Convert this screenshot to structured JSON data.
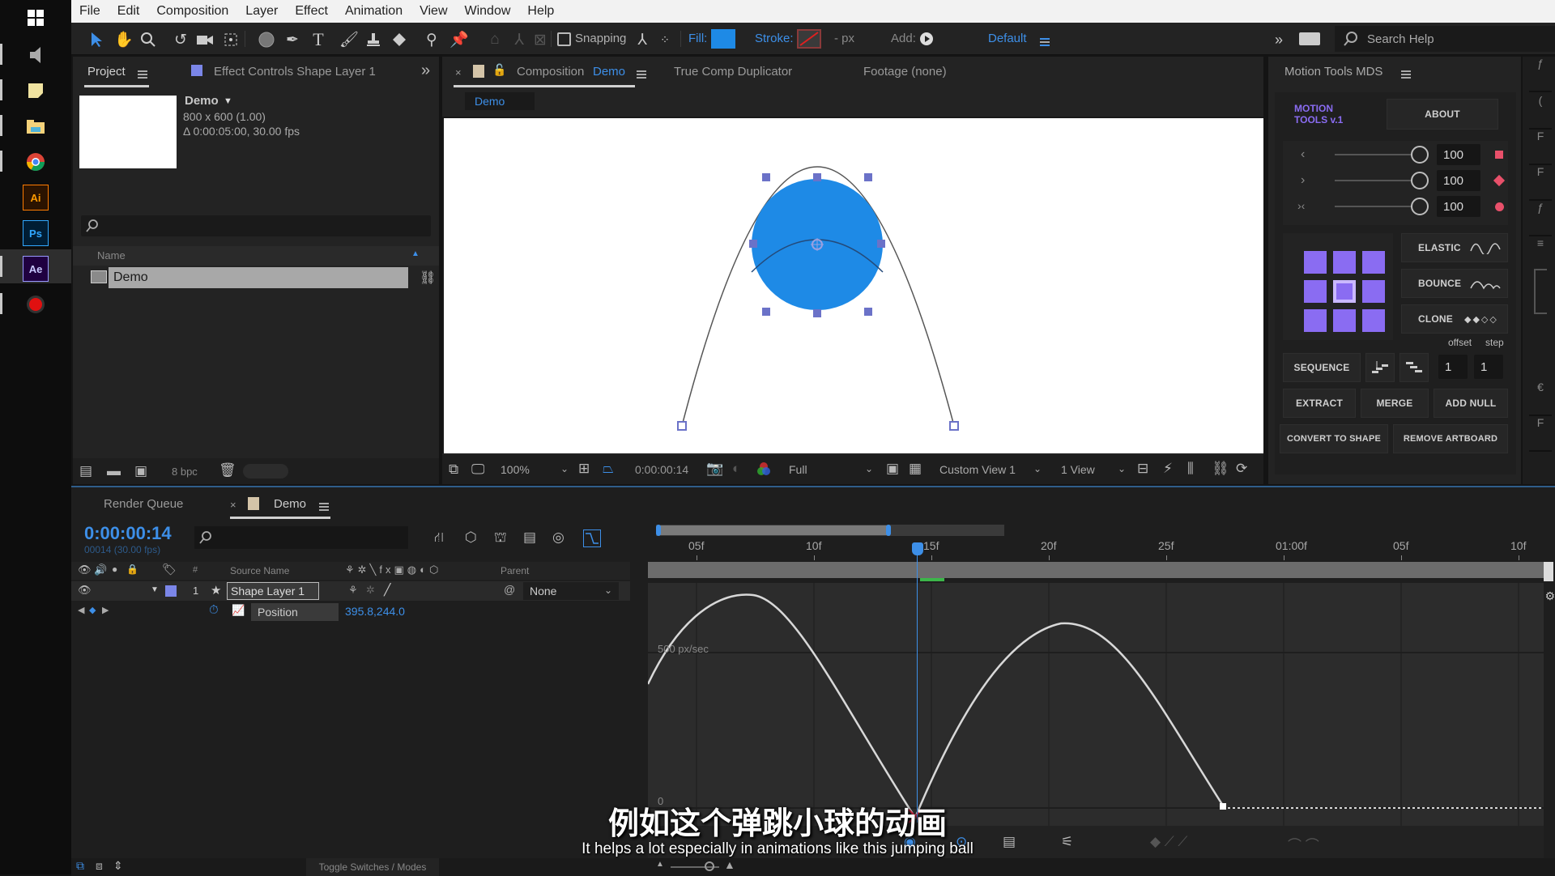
{
  "taskbar": {
    "icons": [
      {
        "name": "windows-start-icon",
        "label": ""
      },
      {
        "name": "speaker-icon",
        "label": ""
      },
      {
        "name": "sticky-notes-icon",
        "label": ""
      },
      {
        "name": "file-explorer-icon",
        "label": ""
      },
      {
        "name": "chrome-icon",
        "label": ""
      },
      {
        "name": "illustrator-icon",
        "label": "Ai"
      },
      {
        "name": "photoshop-icon",
        "label": "Ps"
      },
      {
        "name": "after-effects-icon",
        "label": "Ae"
      },
      {
        "name": "record-icon",
        "label": ""
      }
    ]
  },
  "menubar": {
    "items": [
      "File",
      "Edit",
      "Composition",
      "Layer",
      "Effect",
      "Animation",
      "View",
      "Window",
      "Help"
    ]
  },
  "toolbar": {
    "snapping_label": "Snapping",
    "fill_label": "Fill:",
    "fill_color": "#1e8ae6",
    "stroke_label": "Stroke:",
    "stroke_width": "- px",
    "add_label": "Add:",
    "workspace": "Default",
    "search_placeholder": "Search Help"
  },
  "project_panel": {
    "tab_label": "Project",
    "effect_controls_label": "Effect Controls Shape Layer 1",
    "comp_name": "Demo",
    "comp_size": "800 x 600 (1.00)",
    "comp_duration": "Δ 0:00:05:00, 30.00 fps",
    "column_name": "Name",
    "items": [
      {
        "name": "Demo"
      }
    ],
    "bpc": "8 bpc"
  },
  "composition_panel": {
    "tab_prefix": "Composition",
    "tab_comp": "Demo",
    "other_tabs": [
      "True Comp Duplicator",
      "Footage (none)"
    ],
    "breadcrumb": "Demo",
    "ball_color": "#1e8ae6",
    "zoom": "100%",
    "timecode": "0:00:00:14",
    "resolution": "Full",
    "view": "Custom View 1",
    "view_layout": "1 View"
  },
  "motion_tools": {
    "title": "Motion Tools MDS",
    "logo_line1": "MOTION",
    "logo_line2": "TOOLS v.1",
    "about": "ABOUT",
    "sliders": [
      {
        "icon": "‹",
        "value": "100"
      },
      {
        "icon": "›",
        "value": "100"
      },
      {
        "icon": "›‹",
        "value": "100"
      }
    ],
    "elastic": "ELASTIC",
    "bounce": "BOUNCE",
    "clone": "CLONE",
    "offset_label": "offset",
    "step_label": "step",
    "sequence": "SEQUENCE",
    "offset_value": "1",
    "step_value": "1",
    "extract": "EXTRACT",
    "merge": "MERGE",
    "add_null": "ADD NULL",
    "convert_to_shape": "CONVERT TO SHAPE",
    "remove_artboard": "REMOVE ARTBOARD",
    "accent_color": "#8a6cf2"
  },
  "side_strip": {
    "labels": [
      "ƒ",
      "(",
      "F",
      "F",
      "ƒ",
      "≡",
      "",
      "€",
      "F"
    ]
  },
  "timeline": {
    "render_queue_tab": "Render Queue",
    "comp_tab": "Demo",
    "current_time": "0:00:00:14",
    "current_frame": "00014 (30.00 fps)",
    "col_source_name": "Source Name",
    "col_parent": "Parent",
    "col_number": "#",
    "layers": [
      {
        "number": "1",
        "name": "Shape Layer 1",
        "parent": "None",
        "color": "#7b86e8"
      }
    ],
    "property": {
      "name": "Position",
      "value": "395.8,244.0"
    },
    "ruler_labels": [
      "05f",
      "10f",
      "15f",
      "20f",
      "25f",
      "01:00f",
      "05f",
      "10f"
    ],
    "graph_labels": {
      "speed": "500 px/sec",
      "zero": "0"
    },
    "toggle_label": "Toggle Switches / Modes"
  },
  "subtitles": {
    "chinese": "例如这个弹跳小球的动画",
    "english": "It helps a lot especially in animations like this jumping ball"
  }
}
